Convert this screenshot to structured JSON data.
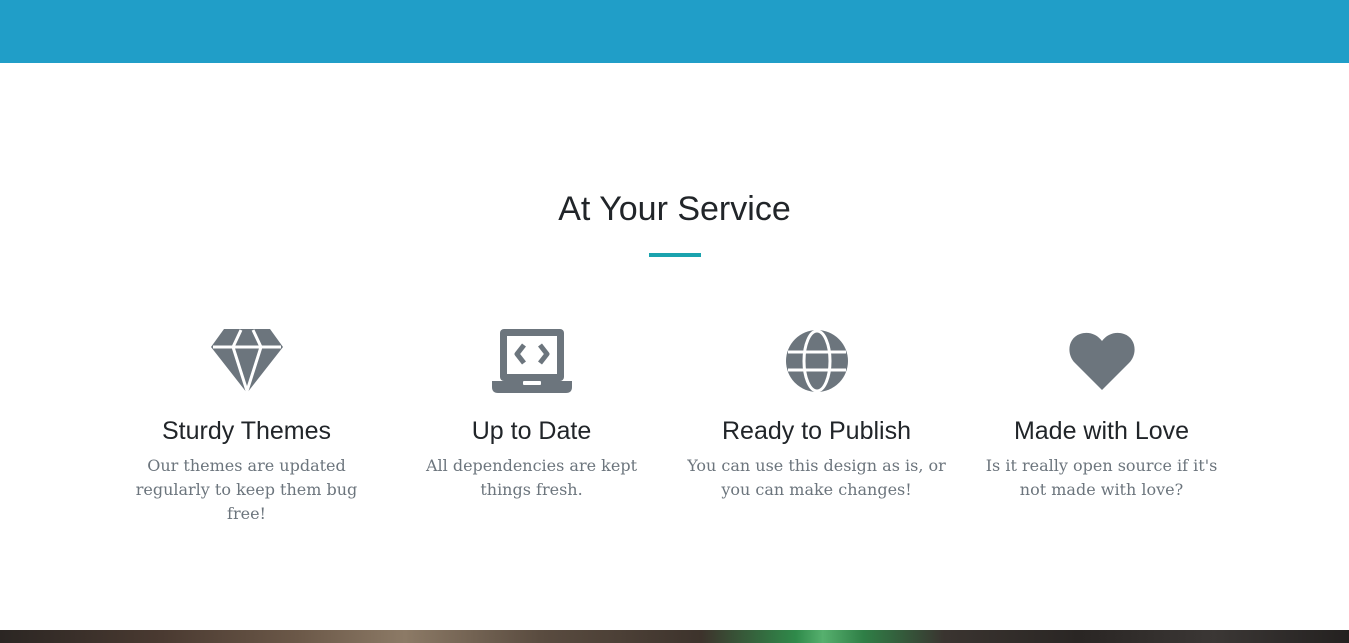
{
  "page": {
    "accent_color": "#209ec8",
    "divider_color": "#1aa3ae",
    "icon_color": "#6c757d"
  },
  "section": {
    "title": "At Your Service"
  },
  "services": [
    {
      "icon": "gem-icon",
      "title": "Sturdy Themes",
      "text": "Our themes are updated regularly to keep them bug free!"
    },
    {
      "icon": "laptop-code-icon",
      "title": "Up to Date",
      "text": "All dependencies are kept things fresh."
    },
    {
      "icon": "globe-icon",
      "title": "Ready to Publish",
      "text": "You can use this design as is, or you can make changes!"
    },
    {
      "icon": "heart-icon",
      "title": "Made with Love",
      "text": "Is it really open source if it's not made with love?"
    }
  ]
}
